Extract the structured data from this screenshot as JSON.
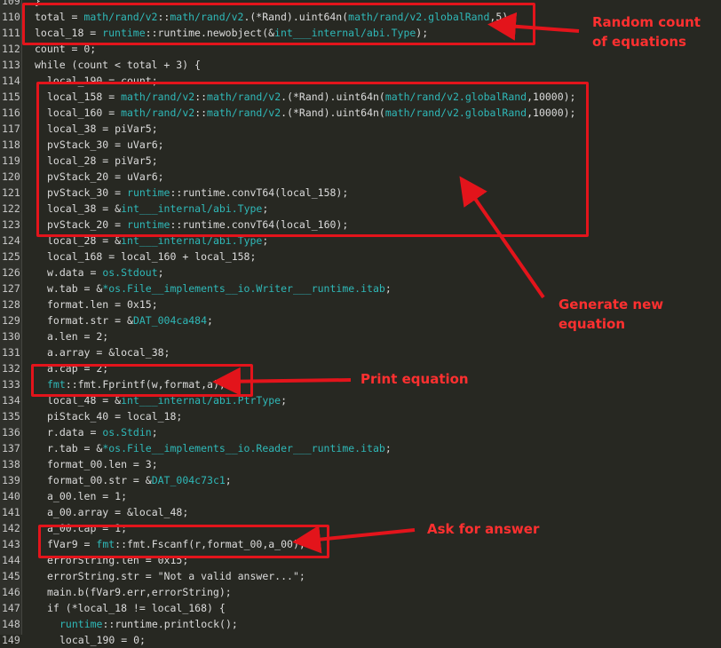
{
  "lines": [
    {
      "n": "109",
      "indent": 0,
      "text": "}"
    },
    {
      "n": "110",
      "indent": 0,
      "text": "total = math/rand/v2::math/rand/v2.(*Rand).uint64n(math/rand/v2.globalRand,5);"
    },
    {
      "n": "111",
      "indent": 0,
      "text": "local_18 = runtime::runtime.newobject(&int___internal/abi.Type);"
    },
    {
      "n": "112",
      "indent": 0,
      "text": "count = 0;"
    },
    {
      "n": "113",
      "indent": 0,
      "text": "while (count < total + 3) {"
    },
    {
      "n": "114",
      "indent": 1,
      "text": "local_190 = count;"
    },
    {
      "n": "115",
      "indent": 1,
      "text": "local_158 = math/rand/v2::math/rand/v2.(*Rand).uint64n(math/rand/v2.globalRand,10000);"
    },
    {
      "n": "116",
      "indent": 1,
      "text": "local_160 = math/rand/v2::math/rand/v2.(*Rand).uint64n(math/rand/v2.globalRand,10000);"
    },
    {
      "n": "117",
      "indent": 1,
      "text": "local_38 = piVar5;"
    },
    {
      "n": "118",
      "indent": 1,
      "text": "pvStack_30 = uVar6;"
    },
    {
      "n": "119",
      "indent": 1,
      "text": "local_28 = piVar5;"
    },
    {
      "n": "120",
      "indent": 1,
      "text": "pvStack_20 = uVar6;"
    },
    {
      "n": "121",
      "indent": 1,
      "text": "pvStack_30 = runtime::runtime.convT64(local_158);"
    },
    {
      "n": "122",
      "indent": 1,
      "text": "local_38 = &int___internal/abi.Type;"
    },
    {
      "n": "123",
      "indent": 1,
      "text": "pvStack_20 = runtime::runtime.convT64(local_160);"
    },
    {
      "n": "124",
      "indent": 1,
      "text": "local_28 = &int___internal/abi.Type;"
    },
    {
      "n": "125",
      "indent": 1,
      "text": "local_168 = local_160 + local_158;"
    },
    {
      "n": "126",
      "indent": 1,
      "text": "w.data = os.Stdout;"
    },
    {
      "n": "127",
      "indent": 1,
      "text": "w.tab = &*os.File__implements__io.Writer___runtime.itab;"
    },
    {
      "n": "128",
      "indent": 1,
      "text": "format.len = 0x15;"
    },
    {
      "n": "129",
      "indent": 1,
      "text": "format.str = &DAT_004ca484;"
    },
    {
      "n": "130",
      "indent": 1,
      "text": "a.len = 2;"
    },
    {
      "n": "131",
      "indent": 1,
      "text": "a.array = &local_38;"
    },
    {
      "n": "132",
      "indent": 1,
      "text": "a.cap = 2;"
    },
    {
      "n": "133",
      "indent": 1,
      "text": "fmt::fmt.Fprintf(w,format,a);"
    },
    {
      "n": "134",
      "indent": 1,
      "text": "local_48 = &int___internal/abi.PtrType;"
    },
    {
      "n": "135",
      "indent": 1,
      "text": "piStack_40 = local_18;"
    },
    {
      "n": "136",
      "indent": 1,
      "text": "r.data = os.Stdin;"
    },
    {
      "n": "137",
      "indent": 1,
      "text": "r.tab = &*os.File__implements__io.Reader___runtime.itab;"
    },
    {
      "n": "138",
      "indent": 1,
      "text": "format_00.len = 3;"
    },
    {
      "n": "139",
      "indent": 1,
      "text": "format_00.str = &DAT_004c73c1;"
    },
    {
      "n": "140",
      "indent": 1,
      "text": "a_00.len = 1;"
    },
    {
      "n": "141",
      "indent": 1,
      "text": "a_00.array = &local_48;"
    },
    {
      "n": "142",
      "indent": 1,
      "text": "a_00.cap = 1;"
    },
    {
      "n": "143",
      "indent": 1,
      "text": "fVar9 = fmt::fmt.Fscanf(r,format_00,a_00);"
    },
    {
      "n": "144",
      "indent": 1,
      "text": "errorString.len = 0x15;"
    },
    {
      "n": "145",
      "indent": 1,
      "text": "errorString.str = \"Not a valid answer...\";"
    },
    {
      "n": "146",
      "indent": 1,
      "text": "main.b(fVar9.err,errorString);"
    },
    {
      "n": "147",
      "indent": 1,
      "text": "if (*local_18 != local_168) {"
    },
    {
      "n": "148",
      "indent": 2,
      "text": "runtime::runtime.printlock();"
    },
    {
      "n": "149",
      "indent": 2,
      "text": "local_190 = 0;"
    }
  ],
  "annotations": {
    "random_count": "Random count\nof equations",
    "generate": "Generate new\nequation",
    "print": "Print equation",
    "ask": "Ask for answer"
  },
  "colors": {
    "background": "#272822",
    "identifier": "#d4d4d4",
    "namespace": "#2fb8b8",
    "annotation": "#e3141b"
  }
}
